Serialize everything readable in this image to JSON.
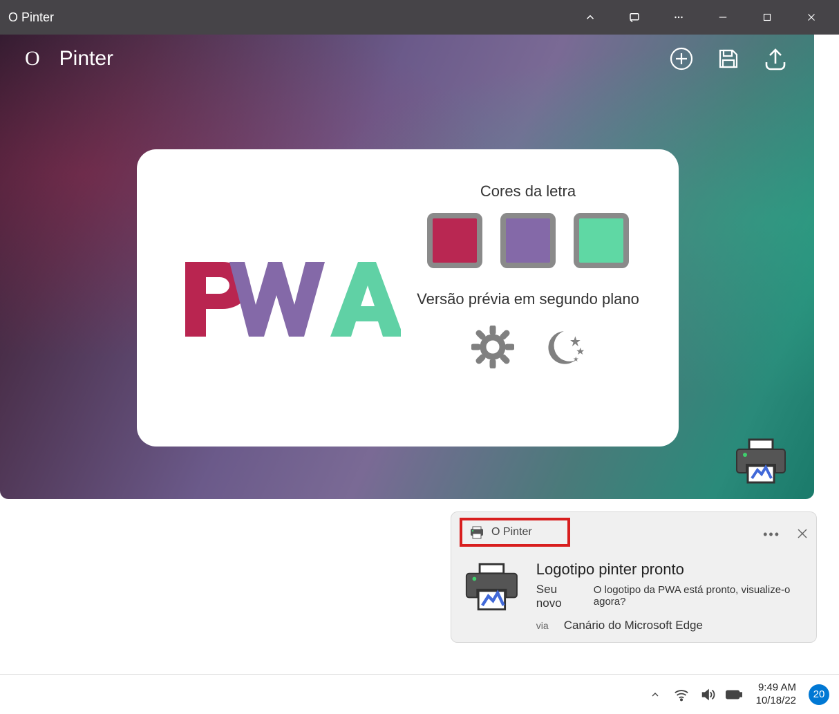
{
  "titlebar": {
    "title": "O Pinter"
  },
  "app": {
    "brand_icon": "O",
    "brand_title": "Pinter"
  },
  "card": {
    "logo": {
      "p": "P",
      "w": "W",
      "a": "A"
    },
    "colors_label": "Cores da letra",
    "swatches": [
      {
        "color": "#b92752"
      },
      {
        "color": "#8469a8"
      },
      {
        "color": "#5fd8a4"
      }
    ],
    "bg_label": "Versão prévia em segundo plano"
  },
  "notification": {
    "app_name": "O Pinter",
    "title": "Logotipo pinter pronto",
    "sub1": "Seu novo",
    "sub2": "O logotipo da PWA está pronto, visualize-o agora?",
    "via_label": "via",
    "via_app": "Canário do Microsoft Edge"
  },
  "taskbar": {
    "time": "9:49 AM",
    "date": "10/18/22",
    "badge": "20"
  }
}
